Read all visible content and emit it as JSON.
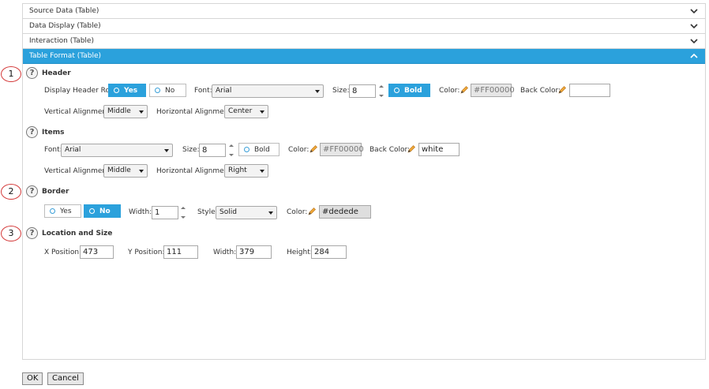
{
  "accent": "#2ba1dc",
  "accordion": [
    {
      "label": "Source Data (Table)",
      "icon": "chevron-down-icon"
    },
    {
      "label": "Data Display (Table)",
      "icon": "chevron-down-icon"
    },
    {
      "label": "Interaction (Table)",
      "icon": "chevron-down-icon"
    },
    {
      "label": "Table Format (Table)",
      "icon": "chevron-up-icon",
      "active": true
    }
  ],
  "callouts": [
    "1",
    "2",
    "3"
  ],
  "header": {
    "title": "Header",
    "display_header_row_label": "Display Header Row",
    "yes_label": "Yes",
    "no_label": "No",
    "font_label": "Font:",
    "font_value": "Arial",
    "size_label": "Size:",
    "size_value": "8",
    "bold_label": "Bold",
    "color_label": "Color:",
    "color_value": "#FF00000",
    "back_color_label": "Back Color:",
    "back_color_value": "",
    "valign_label": "Vertical Alignment:",
    "valign_value": "Middle",
    "halign_label": "Horizontal Alignment:",
    "halign_value": "Center"
  },
  "items": {
    "title": "Items",
    "font_label": "Font:",
    "font_value": "Arial",
    "size_label": "Size:",
    "size_value": "8",
    "bold_label": "Bold",
    "color_label": "Color:",
    "color_value": "#FF00000",
    "back_color_label": "Back Color:",
    "back_color_value": "white",
    "valign_label": "Vertical Alignment:",
    "valign_value": "Middle",
    "halign_label": "Horizontal Alignment:",
    "halign_value": "Right"
  },
  "border": {
    "title": "Border",
    "yes_label": "Yes",
    "no_label": "No",
    "width_label": "Width:",
    "width_value": "1",
    "style_label": "Style:",
    "style_value": "Solid",
    "color_label": "Color:",
    "color_value": "#dedede"
  },
  "location": {
    "title": "Location and Size",
    "x_label": "X Position:",
    "x_value": "473",
    "y_label": "Y Position:",
    "y_value": "111",
    "width_label": "Width:",
    "width_value": "379",
    "height_label": "Height:",
    "height_value": "284"
  },
  "footer": {
    "ok_label": "OK",
    "cancel_label": "Cancel"
  }
}
